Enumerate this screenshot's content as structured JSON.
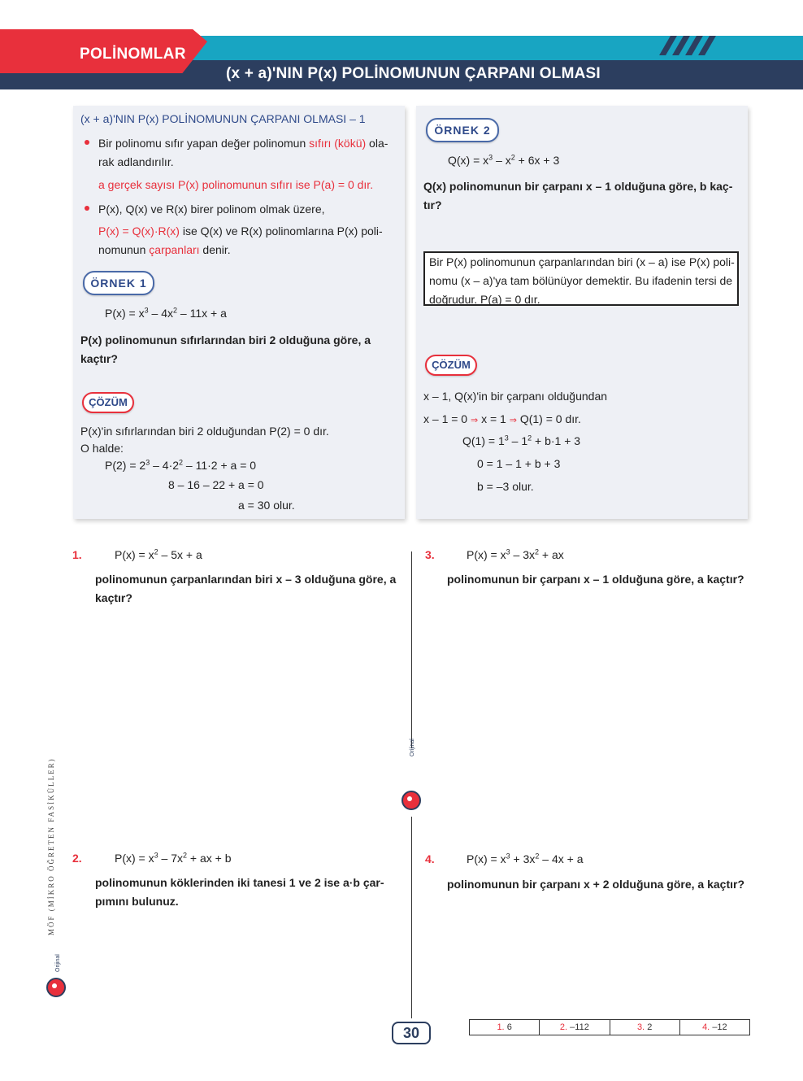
{
  "header": {
    "topic": "POLİNOMLAR",
    "title": "(x + a)'NIN P(x) POLİNOMUNUN ÇARPANI OLMASI",
    "colors": {
      "red": "#e8303c",
      "cyan": "#18a5c2",
      "navy": "#2c3e5f"
    }
  },
  "theory": {
    "heading": "(x + a)'NIN P(x) POLİNOMUNUN ÇARPANI OLMASI – 1",
    "b1_l1_pre": "Bir polinomu sıfır yapan değer polinomun ",
    "b1_l1_red": "sıfırı (kökü)",
    "b1_l1_post": " ola-",
    "b1_l2": "rak adlandırılır.",
    "b1_l3": "a gerçek sayısı P(x) polinomunun sıfırı ise P(a) = 0 dır.",
    "b2_l1": "P(x), Q(x) ve R(x) birer polinom olmak üzere,",
    "b2_l2_red": "P(x) = Q(x)·R(x)",
    "b2_l2_post": "  ise Q(x) ve R(x) polinomlarına P(x) poli-",
    "b2_l3_pre": "nomunun ",
    "b2_l3_red": "çarpanları",
    "b2_l3_post": " denir."
  },
  "example1": {
    "badge": "ÖRNEK  1",
    "expr": "P(x) = x³ – 4x² – 11x + a",
    "q_l1": "P(x)  polinomunun  sıfırlarından  biri  2  olduğuna  göre,  a",
    "q_l2": "kaçtır?",
    "sol_badge": "ÇÖZÜM",
    "s1": "P(x)'in sıfırlarından biri 2 olduğundan P(2) = 0 dır.",
    "s2": "O halde:",
    "s3": "P(2) = 2³ – 4·2² – 11·2 + a = 0",
    "s4": "8 – 16 – 22 + a = 0",
    "s5": "a = 30  olur."
  },
  "example2": {
    "badge": "ÖRNEK  2",
    "expr": "Q(x) = x³ – x² + 6x + 3",
    "q_l1": "Q(x) polinomunun bir çarpanı x – 1 olduğuna göre, b kaç-",
    "q_l2": "tır?",
    "note_l1": "Bir P(x) polinomunun çarpanlarından biri (x – a) ise P(x) poli-",
    "note_l2": "nomu (x – a)'ya tam bölünüyor demektir. Bu ifadenin tersi de",
    "note_l3": "doğrudur. P(a) = 0 dır.",
    "sol_badge": "ÇÖZÜM",
    "s1": "x – 1, Q(x)'in bir çarpanı olduğundan",
    "s2a": "x – 1 = 0",
    "s2b": "x = 1",
    "s2c": "Q(1) = 0 dır.",
    "s3": "Q(1)  = 1³ – 1² + b·1 + 3",
    "s4": "0 = 1 – 1 + b + 3",
    "s5": "b = –3  olur."
  },
  "questions": [
    {
      "num": "1.",
      "expr": "P(x) = x² – 5x + a",
      "l1": "polinomunun çarpanlarından biri x – 3 olduğuna göre, a",
      "l2": "kaçtır?"
    },
    {
      "num": "2.",
      "expr": "P(x) = x³ – 7x² + ax + b",
      "l1": "polinomunun köklerinden iki tanesi 1 ve 2 ise a·b çar-",
      "l2": "pımını bulunuz."
    },
    {
      "num": "3.",
      "expr": "P(x) = x³ – 3x² + ax",
      "l1": "polinomunun bir çarpanı x – 1 olduğuna göre, a kaçtır?",
      "l2": ""
    },
    {
      "num": "4.",
      "expr": "P(x) = x³ + 3x² – 4x + a",
      "l1": "polinomunun bir çarpanı x + 2 olduğuna göre, a kaçtır?",
      "l2": ""
    }
  ],
  "footer": {
    "page": "30",
    "side_text": "MÖF (MİKRO ÖĞRETEN FASİKÜLLER)",
    "logo_text": "Orijinal",
    "answers": [
      {
        "n": "1.",
        "v": "6"
      },
      {
        "n": "2.",
        "v": "–112"
      },
      {
        "n": "3.",
        "v": "2"
      },
      {
        "n": "4.",
        "v": "–12"
      }
    ]
  }
}
